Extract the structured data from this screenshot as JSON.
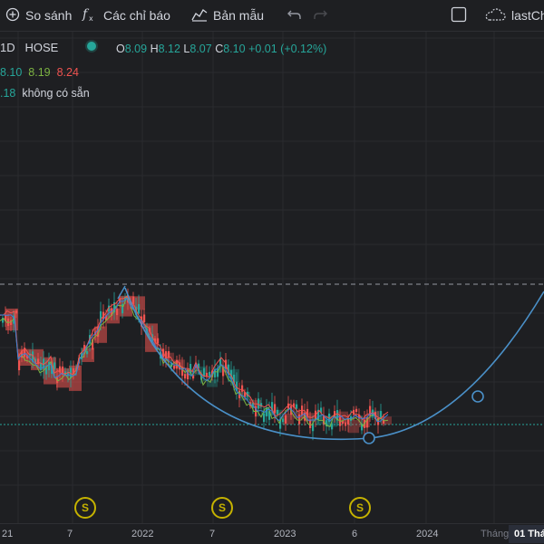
{
  "toolbar": {
    "compare_label": "So sánh",
    "indicators_label": "Các chỉ báo",
    "templates_label": "Bản mẫu",
    "layout_label": "lastCh"
  },
  "legend": {
    "interval": "1D",
    "exchange": "HOSE",
    "ohlc": {
      "o_label": "O",
      "o_value": "8.09",
      "h_label": "H",
      "h_value": "8.12",
      "l_label": "L",
      "l_value": "8.07",
      "c_label": "C",
      "c_value": "8.10",
      "change": "+0.01 (+0.12%)"
    },
    "indicator_values": [
      "8.10",
      "8.19",
      "8.24"
    ],
    "indicator2_value": ".18",
    "unavailable": "không có sẵn"
  },
  "x_axis": {
    "ticks": [
      "21",
      "7",
      "2022",
      "7",
      "2023",
      "6",
      "2024",
      "Tháng"
    ],
    "highlight": "01 Thá"
  },
  "dividend_marker": "S",
  "colors": {
    "background": "#1e1f22",
    "up": "#26a69a",
    "down": "#ef5350",
    "curve": "#4a90c8",
    "dividend": "#c5b200"
  }
}
